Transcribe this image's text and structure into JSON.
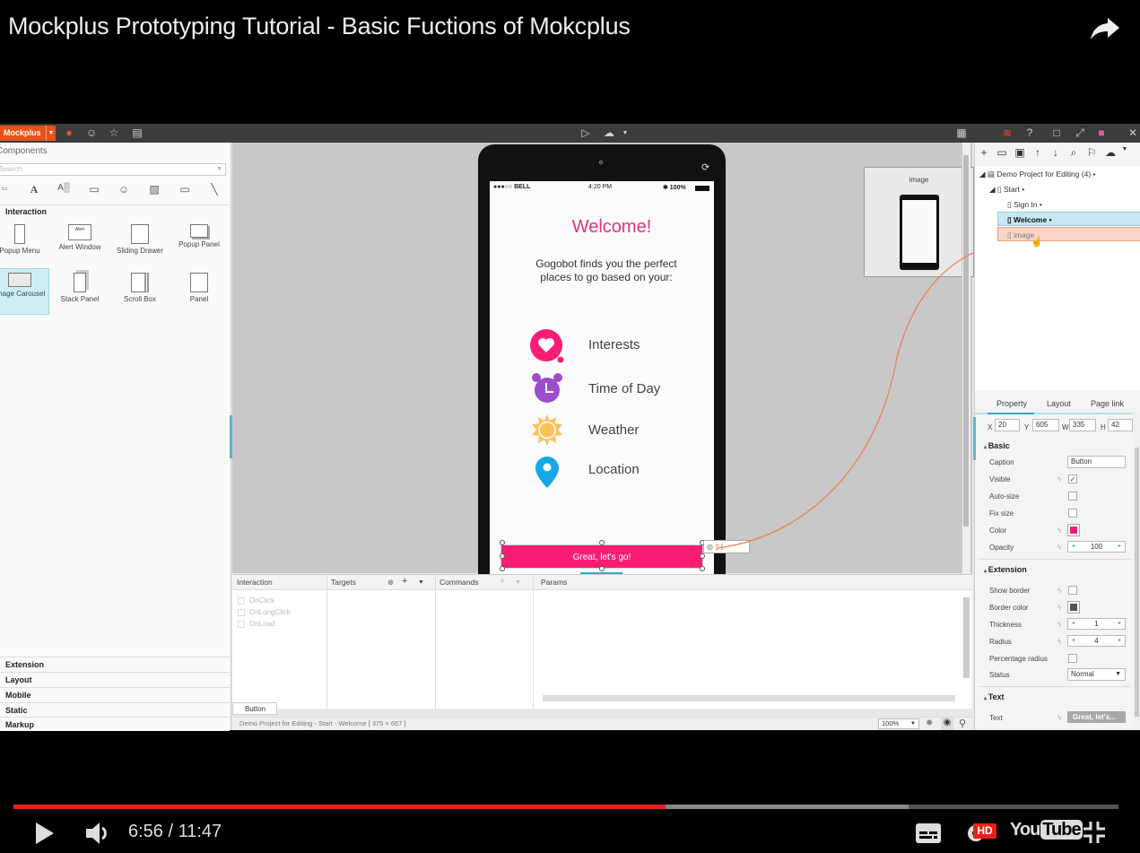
{
  "video": {
    "title": "Mockplus Prototyping Tutorial - Basic Fuctions of Mokcplus",
    "current_time": "6:56",
    "duration": "11:47",
    "time_display": "6:56 / 11:47",
    "progress_percent": 59,
    "buffered_percent": 81,
    "hd_badge": "HD",
    "youtube_logo": "YouTube",
    "colors": {
      "progress": "#e62117",
      "hd": "#e62117"
    }
  },
  "app": {
    "brand": "Mockplus",
    "brand_color": "#e8521a",
    "left_panel": {
      "title": "Components",
      "search_placeholder": "Search",
      "tools": [
        "button-icon",
        "text-icon",
        "label-icon",
        "rectangle-icon",
        "emoji-icon",
        "image-icon",
        "input-icon",
        "line-icon"
      ],
      "section": "Interaction",
      "components": [
        {
          "label": "Popup Menu",
          "icon": "popup-menu-icon"
        },
        {
          "label": "Alert Window",
          "icon": "alert-window-icon",
          "glyph": "Alert"
        },
        {
          "label": "Sliding Drawer",
          "icon": "sliding-drawer-icon"
        },
        {
          "label": "Popup Panel",
          "icon": "popup-panel-icon"
        },
        {
          "label": "Image Carousel",
          "icon": "image-carousel-icon",
          "selected": true
        },
        {
          "label": "Stack Panel",
          "icon": "stack-panel-icon"
        },
        {
          "label": "Scroll Box",
          "icon": "scroll-box-icon"
        },
        {
          "label": "Panel",
          "icon": "panel-icon"
        }
      ],
      "categories": [
        "Extension",
        "Layout",
        "Mobile",
        "Static",
        "Markup"
      ]
    },
    "phone": {
      "carrier": "●●●○○ BELL",
      "time": "4:20 PM",
      "battery": "✱ 100%",
      "welcome": "Welcome!",
      "tagline": "Gogobot finds you the perfect places to go based on your:",
      "features": [
        {
          "label": "Interests",
          "icon": "heart-icon",
          "color": "#fa1d73"
        },
        {
          "label": "Time of Day",
          "icon": "alarm-clock-icon",
          "color": "#9b4dca"
        },
        {
          "label": "Weather",
          "icon": "sun-icon",
          "color": "#fbc25b"
        },
        {
          "label": "Location",
          "icon": "location-pin-icon",
          "color": "#16a8e8"
        }
      ],
      "button_label": "Great, let's go!",
      "button_color": "#fa1d73"
    },
    "image_preview": {
      "label": "image"
    },
    "tree": {
      "nodes": [
        {
          "label": "Demo Project for Editing (4)",
          "level": 0
        },
        {
          "label": "Start",
          "level": 1
        },
        {
          "label": "Sign In",
          "level": 2
        },
        {
          "label": "Welcome",
          "level": 2,
          "selected": true
        },
        {
          "label": "image",
          "level": 2,
          "highlighted": true
        }
      ]
    },
    "props": {
      "tabs": [
        "Property",
        "Layout",
        "Page link"
      ],
      "active_tab": "Property",
      "x": "20",
      "y": "605",
      "w": "335",
      "h": "42",
      "basic_header": "Basic",
      "caption_label": "Caption",
      "caption_value": "Button",
      "visible_label": "Visible",
      "visible": true,
      "autosize_label": "Auto-size",
      "fixsize_label": "Fix size",
      "color_label": "Color",
      "color_value": "#fa1d73",
      "opacity_label": "Opacity",
      "opacity_value": "100",
      "extension_header": "Extension",
      "show_border_label": "Show border",
      "border_color_label": "Border color",
      "border_color_value": "#555555",
      "thickness_label": "Thickness",
      "thickness_value": "1",
      "radius_label": "Radius",
      "radius_value": "4",
      "pct_radius_label": "Percentage radius",
      "status_label": "Status",
      "status_value": "Normal",
      "text_header": "Text",
      "text_label": "Text",
      "text_value": "Great, let's..."
    },
    "interaction": {
      "headers": {
        "interaction": "Interaction",
        "targets": "Targets",
        "commands": "Commands",
        "params": "Params"
      },
      "events": [
        "OnClick",
        "OnLongClick",
        "OnLoad"
      ],
      "element_tab": "Button"
    },
    "statusbar": {
      "path": "Demo Project for Editing - Start - Welcome [ 375 × 667 ]",
      "zoom": "100%"
    }
  }
}
